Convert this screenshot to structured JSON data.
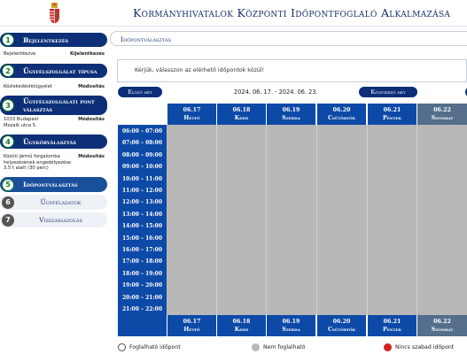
{
  "app": {
    "title": "Kormányhivatalok Központi Időpontfoglaló Alkalmazása"
  },
  "colors": {
    "navy": "#0d2f78",
    "blue": "#0d4aa8",
    "saturday": "#546e8c",
    "unavailable": "#b8b8b8",
    "no_free": "#d42020",
    "step_check": "#0d7a2c"
  },
  "steps": [
    {
      "num": "1",
      "label": "Bejelentkezés",
      "state": "done"
    },
    {
      "num": "2",
      "label": "Ügyfélszolgálat típusa",
      "state": "done"
    },
    {
      "num": "3",
      "label": "Ügyfélszolgálati pont választás",
      "state": "done"
    },
    {
      "num": "4",
      "label": "Ügykörválasztás",
      "state": "done"
    },
    {
      "num": "5",
      "label": "Időpontválasztás",
      "state": "current"
    },
    {
      "num": "6",
      "label": "Ügyféladatok",
      "state": "pending"
    },
    {
      "num": "7",
      "label": "Visszaigazolás",
      "state": "pending"
    }
  ],
  "summaries": {
    "login": {
      "text": "Bejelentkezve",
      "action": "Kijelentkezés"
    },
    "type": {
      "text": "Közlekedésfelügyelet",
      "action": "Módosítás"
    },
    "point": {
      "line1": "1033 Budapest",
      "line2": "Mozaik utca 5.",
      "action": "Módosítás"
    },
    "case": {
      "line1": "Közúti jármű forgalomba",
      "line2": "helyezésének engedélyezése",
      "line3": "3.5 t alatt (30 perc)",
      "action": "Módosítás"
    }
  },
  "section": {
    "title": "Időpontválasztás"
  },
  "notice": {
    "text": "Kérjük, válasszon az elérhető időpontok közül!"
  },
  "nav": {
    "prev": "Előző hét",
    "next": "Következő hét",
    "range": "2024. 06. 17. - 2024. 06. 23."
  },
  "days": [
    {
      "date": "06.17",
      "name": "Hétfő"
    },
    {
      "date": "06.18",
      "name": "Kedd"
    },
    {
      "date": "06.19",
      "name": "Szerda"
    },
    {
      "date": "06.20",
      "name": "Csütörtök"
    },
    {
      "date": "06.21",
      "name": "Péntek"
    },
    {
      "date": "06.22",
      "name": "Szombat"
    }
  ],
  "times": [
    "06:00 – 07:00",
    "07:00 – 08:00",
    "08:00 – 09:00",
    "09:00 – 10:00",
    "10:00 – 11:00",
    "11:00 – 12:00",
    "12:00 – 13:00",
    "13:00 – 14:00",
    "14:00 – 15:00",
    "15:00 – 16:00",
    "16:00 – 17:00",
    "17:00 – 18:00",
    "18:00 – 19:00",
    "19:00 – 20:00",
    "20:00 – 21:00",
    "21:00 – 22:00"
  ],
  "legend": {
    "available": "Foglalható időpont",
    "unavailable": "Nem foglalható",
    "no_free": "Nincs szabad időpont"
  }
}
